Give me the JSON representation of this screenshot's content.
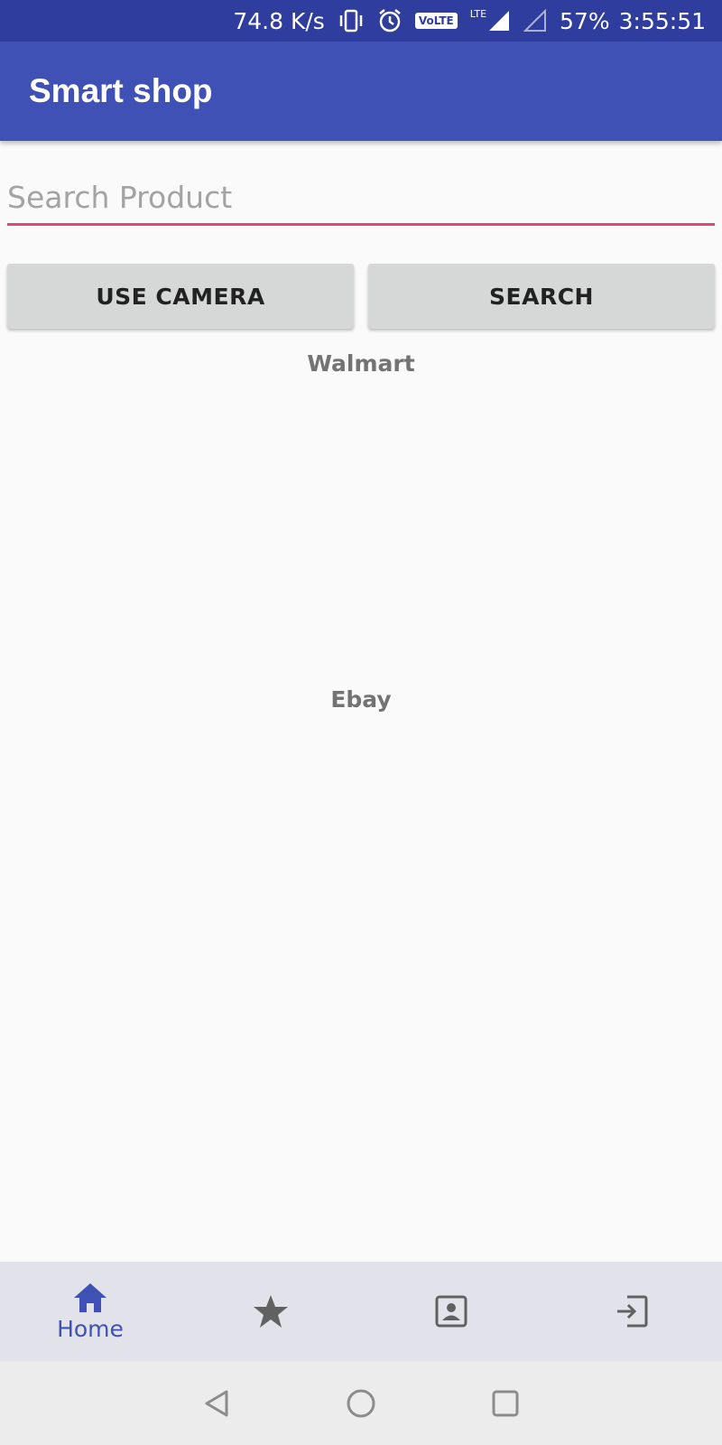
{
  "status_bar": {
    "net_speed": "74.8 K/s",
    "volte": "VoLTE",
    "lte": "LTE",
    "battery": "57%",
    "time": "3:55:51",
    "icons": [
      "vibrate-icon",
      "alarm-icon",
      "volte-icon",
      "lte-signal-icon",
      "signal-icon"
    ]
  },
  "app_bar": {
    "title": "Smart shop",
    "color": "#3f51b5"
  },
  "search": {
    "placeholder": "Search Product",
    "value": "",
    "underline_color": "#e0457f"
  },
  "buttons": {
    "camera_label": "USE CAMERA",
    "search_label": "SEARCH"
  },
  "sections": {
    "walmart": "Walmart",
    "ebay": "Ebay"
  },
  "bottom_nav": {
    "items": [
      {
        "icon": "home-icon",
        "label": "Home",
        "active": true
      },
      {
        "icon": "star-icon",
        "label": ""
      },
      {
        "icon": "contact-icon",
        "label": ""
      },
      {
        "icon": "exit-icon",
        "label": ""
      }
    ],
    "active_color": "#3f51b5",
    "inactive_color": "#616161"
  },
  "system_nav": {
    "icons": [
      "back-icon",
      "home-circle-icon",
      "recents-icon"
    ]
  }
}
